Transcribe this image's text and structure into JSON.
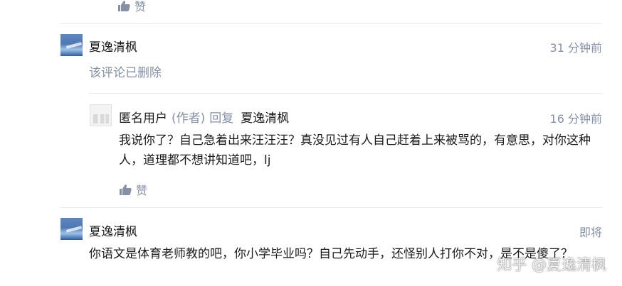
{
  "top": {
    "like_label": "赞"
  },
  "comments": [
    {
      "author": "夏逸清枫",
      "time": "31 分钟前",
      "status": "该评论已删除"
    },
    {
      "author": "匿名用户",
      "author_tag": "(作者)",
      "reply_word": "回复",
      "reply_to": "夏逸清枫",
      "time": "16 分钟前",
      "text": "我说你了？自己急着出来汪汪汪？真没见过有人自己赶着上来被骂的，有意思，对你这种人，道理都不想讲知道吧，lj",
      "like_label": "赞"
    },
    {
      "author": "夏逸清枫",
      "time": "即将",
      "text": "你语文是体育老师教的吧，你小学毕业吗？自己先动手，还怪别人打你不对，是不是傻了？"
    }
  ],
  "watermark": "知乎 @夏逸清枫",
  "colors": {
    "muted": "#8590a6",
    "text": "#1a1a1a",
    "divider": "#ebebeb"
  }
}
